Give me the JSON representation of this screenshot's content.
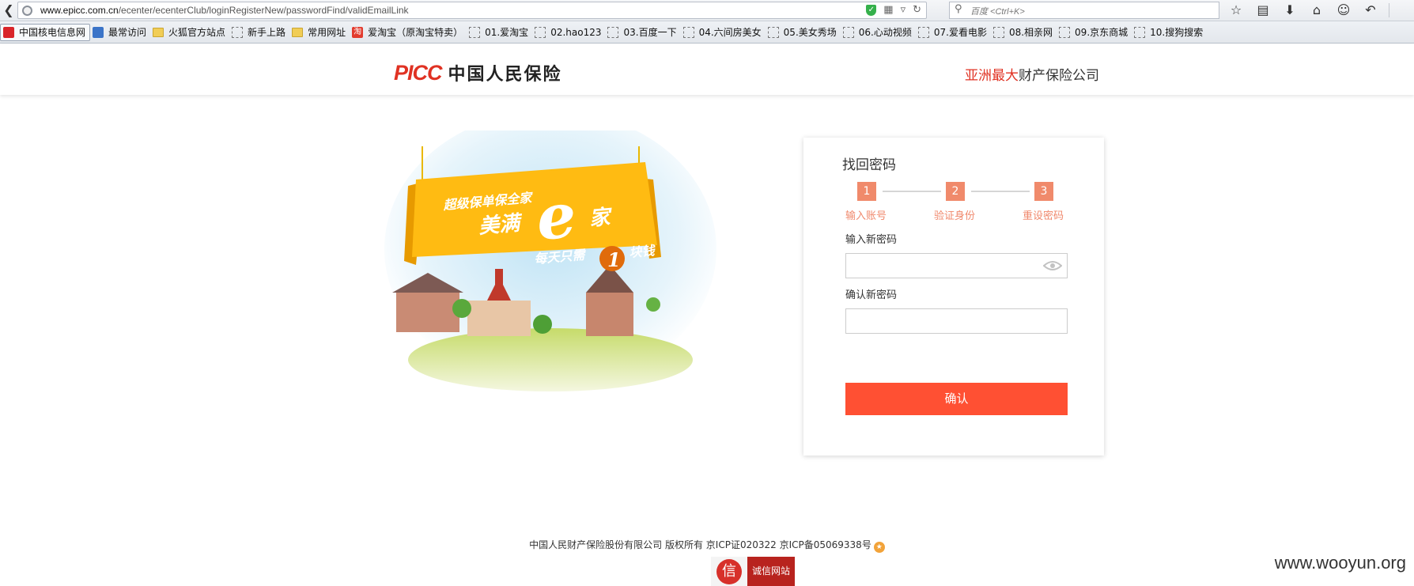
{
  "browser": {
    "url_host": "www.epicc.com.cn",
    "url_path": "/ecenter/ecenterClub/loginRegisterNew/passwordFind/validEmailLink",
    "search_placeholder": "百度 <Ctrl+K>"
  },
  "bookmarks": [
    {
      "label": "中国核电信息网",
      "icon": "red-square-icon"
    },
    {
      "label": "最常访问",
      "icon": "blue-square-icon"
    },
    {
      "label": "火狐官方站点",
      "icon": "folder-icon"
    },
    {
      "label": "新手上路",
      "icon": "dashed-page-icon"
    },
    {
      "label": "常用网址",
      "icon": "folder-icon"
    },
    {
      "label": "爱淘宝（原淘宝特卖）",
      "icon": "taobao-icon"
    },
    {
      "label": "01.爱淘宝",
      "icon": "dashed-page-icon"
    },
    {
      "label": "02.hao123",
      "icon": "dashed-page-icon"
    },
    {
      "label": "03.百度一下",
      "icon": "dashed-page-icon"
    },
    {
      "label": "04.六间房美女",
      "icon": "dashed-page-icon"
    },
    {
      "label": "05.美女秀场",
      "icon": "dashed-page-icon"
    },
    {
      "label": "06.心动视频",
      "icon": "dashed-page-icon"
    },
    {
      "label": "07.爱看电影",
      "icon": "dashed-page-icon"
    },
    {
      "label": "08.相亲网",
      "icon": "dashed-page-icon"
    },
    {
      "label": "09.京东商城",
      "icon": "dashed-page-icon"
    },
    {
      "label": "10.搜狗搜索",
      "icon": "dashed-page-icon"
    }
  ],
  "header": {
    "logo_mark": "PICC",
    "logo_name": "中国人民保险",
    "slogan_highlight": "亚洲最大",
    "slogan_rest": "财产保险公司"
  },
  "banner": {
    "line1": "超级保单保全家",
    "line2": "美满",
    "big_letter": "e",
    "line3": "家",
    "line4_a": "每天只需",
    "line4_num": "1",
    "line4_b": "块钱"
  },
  "form": {
    "title": "找回密码",
    "steps": [
      {
        "num": "1",
        "label": "输入账号"
      },
      {
        "num": "2",
        "label": "验证身份"
      },
      {
        "num": "3",
        "label": "重设密码"
      }
    ],
    "new_password_label": "输入新密码",
    "new_password_value": "",
    "confirm_password_label": "确认新密码",
    "confirm_password_value": "",
    "confirm_button": "确认"
  },
  "footer": {
    "copyright": "中国人民财产保险股份有限公司 版权所有 京ICP证020322 京ICP备05069338号",
    "badge_char": "信",
    "badge_text": "诚信网站"
  },
  "watermark": "www.wooyun.org",
  "colors": {
    "brand_red": "#e03223",
    "step_orange": "#f08a6b",
    "button_red": "#ff5033"
  }
}
